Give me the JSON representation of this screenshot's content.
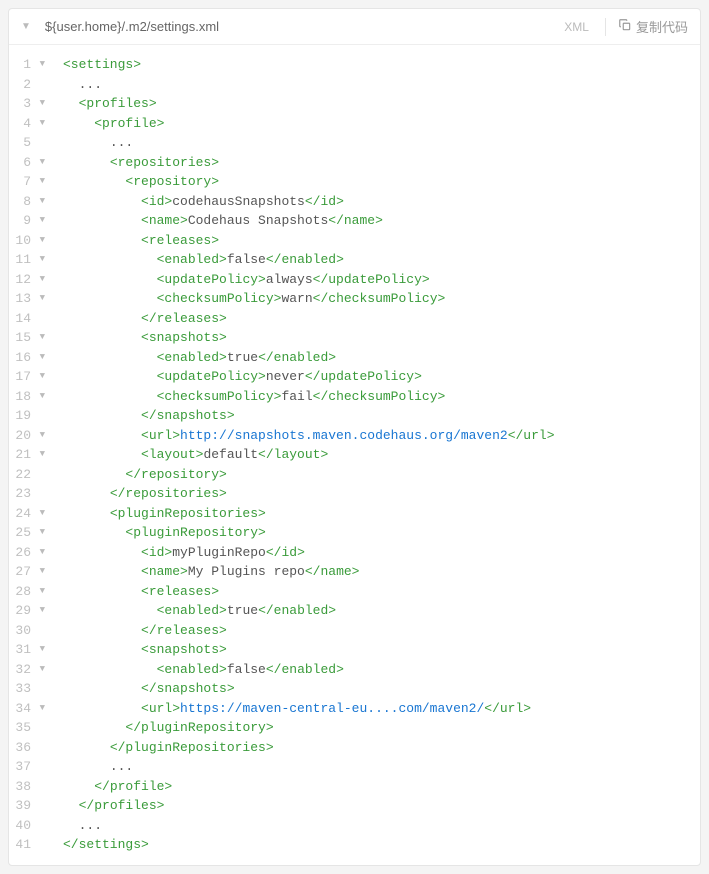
{
  "header": {
    "filepath": "${user.home}/.m2/settings.xml",
    "language": "XML",
    "copy_label": "复制代码"
  },
  "code": {
    "lines": [
      {
        "n": 1,
        "f": true,
        "indent": 0,
        "content": [
          {
            "t": "tag",
            "v": "<settings>"
          }
        ]
      },
      {
        "n": 2,
        "f": false,
        "indent": 1,
        "content": [
          {
            "t": "txt",
            "v": "..."
          }
        ]
      },
      {
        "n": 3,
        "f": true,
        "indent": 1,
        "content": [
          {
            "t": "tag",
            "v": "<profiles>"
          }
        ]
      },
      {
        "n": 4,
        "f": true,
        "indent": 2,
        "content": [
          {
            "t": "tag",
            "v": "<profile>"
          }
        ]
      },
      {
        "n": 5,
        "f": false,
        "indent": 3,
        "content": [
          {
            "t": "txt",
            "v": "..."
          }
        ]
      },
      {
        "n": 6,
        "f": true,
        "indent": 3,
        "content": [
          {
            "t": "tag",
            "v": "<repositories>"
          }
        ]
      },
      {
        "n": 7,
        "f": true,
        "indent": 4,
        "content": [
          {
            "t": "tag",
            "v": "<repository>"
          }
        ]
      },
      {
        "n": 8,
        "f": true,
        "indent": 5,
        "content": [
          {
            "t": "tag",
            "v": "<id>"
          },
          {
            "t": "val",
            "v": "codehausSnapshots"
          },
          {
            "t": "tag",
            "v": "</id>"
          }
        ]
      },
      {
        "n": 9,
        "f": true,
        "indent": 5,
        "content": [
          {
            "t": "tag",
            "v": "<name>"
          },
          {
            "t": "val",
            "v": "Codehaus Snapshots"
          },
          {
            "t": "tag",
            "v": "</name>"
          }
        ]
      },
      {
        "n": 10,
        "f": true,
        "indent": 5,
        "content": [
          {
            "t": "tag",
            "v": "<releases>"
          }
        ]
      },
      {
        "n": 11,
        "f": true,
        "indent": 6,
        "content": [
          {
            "t": "tag",
            "v": "<enabled>"
          },
          {
            "t": "val",
            "v": "false"
          },
          {
            "t": "tag",
            "v": "</enabled>"
          }
        ]
      },
      {
        "n": 12,
        "f": true,
        "indent": 6,
        "content": [
          {
            "t": "tag",
            "v": "<updatePolicy>"
          },
          {
            "t": "val",
            "v": "always"
          },
          {
            "t": "tag",
            "v": "</updatePolicy>"
          }
        ]
      },
      {
        "n": 13,
        "f": true,
        "indent": 6,
        "content": [
          {
            "t": "tag",
            "v": "<checksumPolicy>"
          },
          {
            "t": "val",
            "v": "warn"
          },
          {
            "t": "tag",
            "v": "</checksumPolicy>"
          }
        ]
      },
      {
        "n": 14,
        "f": false,
        "indent": 5,
        "content": [
          {
            "t": "tag",
            "v": "</releases>"
          }
        ]
      },
      {
        "n": 15,
        "f": true,
        "indent": 5,
        "content": [
          {
            "t": "tag",
            "v": "<snapshots>"
          }
        ]
      },
      {
        "n": 16,
        "f": true,
        "indent": 6,
        "content": [
          {
            "t": "tag",
            "v": "<enabled>"
          },
          {
            "t": "val",
            "v": "true"
          },
          {
            "t": "tag",
            "v": "</enabled>"
          }
        ]
      },
      {
        "n": 17,
        "f": true,
        "indent": 6,
        "content": [
          {
            "t": "tag",
            "v": "<updatePolicy>"
          },
          {
            "t": "val",
            "v": "never"
          },
          {
            "t": "tag",
            "v": "</updatePolicy>"
          }
        ]
      },
      {
        "n": 18,
        "f": true,
        "indent": 6,
        "content": [
          {
            "t": "tag",
            "v": "<checksumPolicy>"
          },
          {
            "t": "val",
            "v": "fail"
          },
          {
            "t": "tag",
            "v": "</checksumPolicy>"
          }
        ]
      },
      {
        "n": 19,
        "f": false,
        "indent": 5,
        "content": [
          {
            "t": "tag",
            "v": "</snapshots>"
          }
        ]
      },
      {
        "n": 20,
        "f": true,
        "indent": 5,
        "content": [
          {
            "t": "tag",
            "v": "<url>"
          },
          {
            "t": "url",
            "v": "http://snapshots.maven.codehaus.org/maven2"
          },
          {
            "t": "tag",
            "v": "</url>"
          }
        ]
      },
      {
        "n": 21,
        "f": true,
        "indent": 5,
        "content": [
          {
            "t": "tag",
            "v": "<layout>"
          },
          {
            "t": "val",
            "v": "default"
          },
          {
            "t": "tag",
            "v": "</layout>"
          }
        ]
      },
      {
        "n": 22,
        "f": false,
        "indent": 4,
        "content": [
          {
            "t": "tag",
            "v": "</repository>"
          }
        ]
      },
      {
        "n": 23,
        "f": false,
        "indent": 3,
        "content": [
          {
            "t": "tag",
            "v": "</repositories>"
          }
        ]
      },
      {
        "n": 24,
        "f": true,
        "indent": 3,
        "content": [
          {
            "t": "tag",
            "v": "<pluginRepositories>"
          }
        ]
      },
      {
        "n": 25,
        "f": true,
        "indent": 4,
        "content": [
          {
            "t": "tag",
            "v": "<pluginRepository>"
          }
        ]
      },
      {
        "n": 26,
        "f": true,
        "indent": 5,
        "content": [
          {
            "t": "tag",
            "v": "<id>"
          },
          {
            "t": "val",
            "v": "myPluginRepo"
          },
          {
            "t": "tag",
            "v": "</id>"
          }
        ]
      },
      {
        "n": 27,
        "f": true,
        "indent": 5,
        "content": [
          {
            "t": "tag",
            "v": "<name>"
          },
          {
            "t": "val",
            "v": "My Plugins repo"
          },
          {
            "t": "tag",
            "v": "</name>"
          }
        ]
      },
      {
        "n": 28,
        "f": true,
        "indent": 5,
        "content": [
          {
            "t": "tag",
            "v": "<releases>"
          }
        ]
      },
      {
        "n": 29,
        "f": true,
        "indent": 6,
        "content": [
          {
            "t": "tag",
            "v": "<enabled>"
          },
          {
            "t": "val",
            "v": "true"
          },
          {
            "t": "tag",
            "v": "</enabled>"
          }
        ]
      },
      {
        "n": 30,
        "f": false,
        "indent": 5,
        "content": [
          {
            "t": "tag",
            "v": "</releases>"
          }
        ]
      },
      {
        "n": 31,
        "f": true,
        "indent": 5,
        "content": [
          {
            "t": "tag",
            "v": "<snapshots>"
          }
        ]
      },
      {
        "n": 32,
        "f": true,
        "indent": 6,
        "content": [
          {
            "t": "tag",
            "v": "<enabled>"
          },
          {
            "t": "val",
            "v": "false"
          },
          {
            "t": "tag",
            "v": "</enabled>"
          }
        ]
      },
      {
        "n": 33,
        "f": false,
        "indent": 5,
        "content": [
          {
            "t": "tag",
            "v": "</snapshots>"
          }
        ]
      },
      {
        "n": 34,
        "f": true,
        "indent": 5,
        "content": [
          {
            "t": "tag",
            "v": "<url>"
          },
          {
            "t": "url",
            "v": "https://maven-central-eu....com/maven2/"
          },
          {
            "t": "tag",
            "v": "</url>"
          }
        ]
      },
      {
        "n": 35,
        "f": false,
        "indent": 4,
        "content": [
          {
            "t": "tag",
            "v": "</pluginRepository>"
          }
        ]
      },
      {
        "n": 36,
        "f": false,
        "indent": 3,
        "content": [
          {
            "t": "tag",
            "v": "</pluginRepositories>"
          }
        ]
      },
      {
        "n": 37,
        "f": false,
        "indent": 3,
        "content": [
          {
            "t": "txt",
            "v": "..."
          }
        ]
      },
      {
        "n": 38,
        "f": false,
        "indent": 2,
        "content": [
          {
            "t": "tag",
            "v": "</profile>"
          }
        ]
      },
      {
        "n": 39,
        "f": false,
        "indent": 1,
        "content": [
          {
            "t": "tag",
            "v": "</profiles>"
          }
        ]
      },
      {
        "n": 40,
        "f": false,
        "indent": 1,
        "content": [
          {
            "t": "txt",
            "v": "..."
          }
        ]
      },
      {
        "n": 41,
        "f": false,
        "indent": 0,
        "content": [
          {
            "t": "tag",
            "v": "</settings>"
          }
        ]
      }
    ]
  }
}
